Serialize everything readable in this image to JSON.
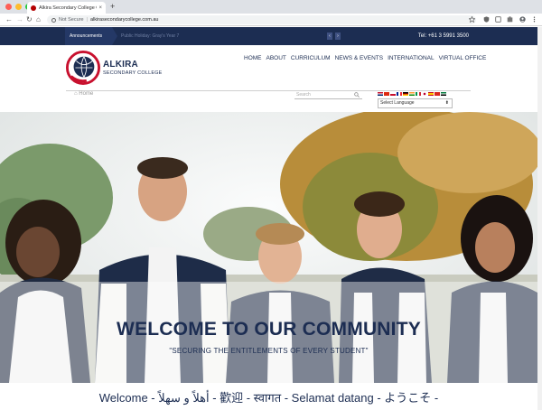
{
  "browser": {
    "tab_title": "Alkira Secondary College Onl...",
    "tab_close": "×",
    "new_tab": "+",
    "security_label": "Not Secure",
    "separator": "|",
    "url": "alkirasecondarycollege.com.au",
    "back": "←",
    "forward": "→",
    "reload": "↻",
    "home": "⌂"
  },
  "topbar": {
    "announcements_label": "Announcements",
    "announcement_text": "Public Holiday: Gray's Year 7",
    "prev": "‹",
    "next": "›",
    "phone": "Tel: +61 3 5991 3500"
  },
  "header": {
    "brand_line1": "ALKIRA",
    "brand_line2": "SECONDARY COLLEGE",
    "nav": [
      "HOME",
      "ABOUT",
      "CURRICULUM",
      "NEWS & EVENTS",
      "INTERNATIONAL",
      "VIRTUAL OFFICE"
    ],
    "breadcrumb_home": "Home",
    "search_placeholder": "Search",
    "language_select": "Select Language",
    "language_caret": "⬍"
  },
  "hero": {
    "title": "WELCOME TO OUR COMMUNITY",
    "subtitle": "\"SECURING THE ENTITLEMENTS OF EVERY STUDENT\""
  },
  "welcome_line": "Welcome - أهلاً و سهلاً - 歡迎 - स्वागत - Selamat datang - ようこそ -",
  "colors": {
    "navy": "#1c2d52",
    "brand_red": "#c8102e"
  }
}
